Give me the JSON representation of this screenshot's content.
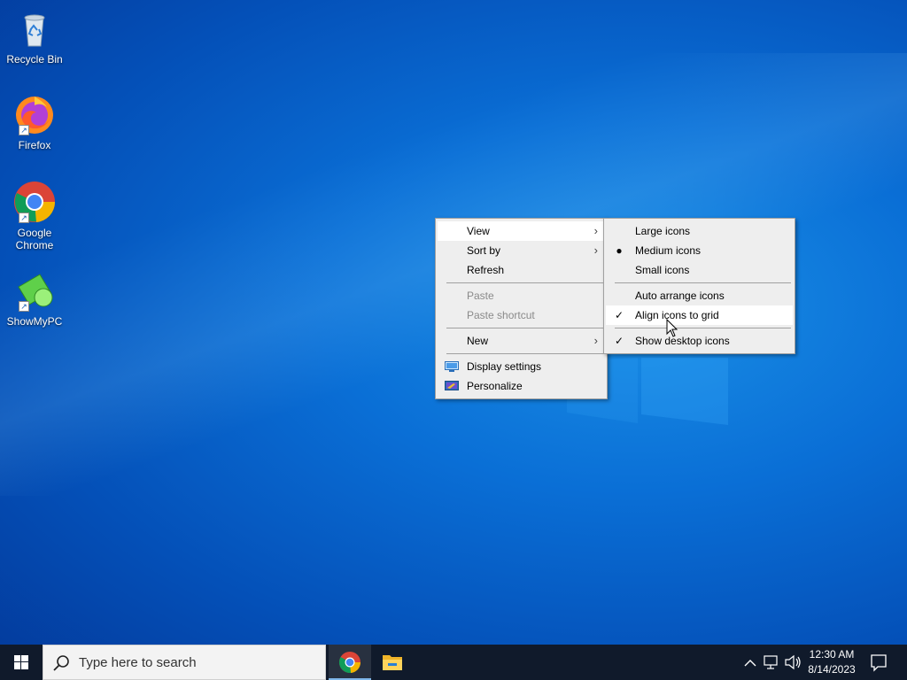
{
  "desktop": {
    "icons": [
      {
        "label": "Recycle Bin",
        "icon": "recycle-bin-icon"
      },
      {
        "label": "Firefox",
        "icon": "firefox-icon"
      },
      {
        "label": "Google Chrome",
        "icon": "chrome-icon"
      },
      {
        "label": "ShowMyPC",
        "icon": "showmypc-icon"
      }
    ]
  },
  "context_menu": {
    "items": {
      "view": "View",
      "sort_by": "Sort by",
      "refresh": "Refresh",
      "paste": "Paste",
      "paste_shortcut": "Paste shortcut",
      "new": "New",
      "display_settings": "Display settings",
      "personalize": "Personalize"
    }
  },
  "view_submenu": {
    "large_icons": "Large icons",
    "medium_icons": "Medium icons",
    "small_icons": "Small icons",
    "auto_arrange": "Auto arrange icons",
    "align_to_grid": "Align icons to grid",
    "show_desktop_icons": "Show desktop icons",
    "selected_size": "Medium icons",
    "auto_arrange_checked": false,
    "align_to_grid_checked": true,
    "show_desktop_icons_checked": true
  },
  "taskbar": {
    "search_placeholder": "Type here to search",
    "apps": [
      "chrome-icon",
      "file-explorer-icon"
    ],
    "clock": {
      "time": "12:30 AM",
      "date": "8/14/2023"
    }
  },
  "colors": {
    "menu_bg": "#eeeeee",
    "taskbar_bg": "#101a2b",
    "desktop_accent": "#0a6fd6"
  }
}
